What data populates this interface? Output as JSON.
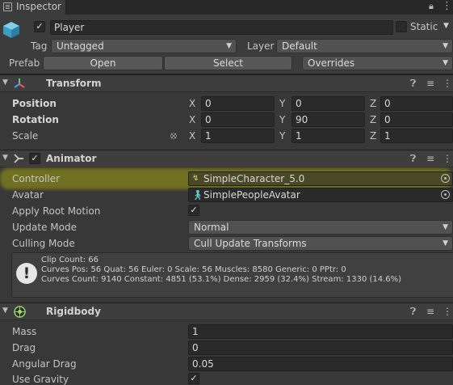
{
  "tab": {
    "title": "Inspector"
  },
  "header": {
    "name": "Player",
    "active_checked": true,
    "static_label": "Static",
    "tag_label": "Tag",
    "tag_value": "Untagged",
    "layer_label": "Layer",
    "layer_value": "Default",
    "prefab_label": "Prefab",
    "open_label": "Open",
    "select_label": "Select",
    "overrides_label": "Overrides"
  },
  "transform": {
    "title": "Transform",
    "position": {
      "label": "Position",
      "x": "0",
      "y": "0",
      "z": "0"
    },
    "rotation": {
      "label": "Rotation",
      "x": "0",
      "y": "90",
      "z": "0"
    },
    "scale": {
      "label": "Scale",
      "x": "1",
      "y": "1",
      "z": "1"
    },
    "axis_x": "X",
    "axis_y": "Y",
    "axis_z": "Z"
  },
  "animator": {
    "title": "Animator",
    "enabled": true,
    "controller_label": "Controller",
    "controller_value": "SimpleCharacter_5.0",
    "avatar_label": "Avatar",
    "avatar_value": "SimplePeopleAvatar",
    "apply_root_motion_label": "Apply Root Motion",
    "apply_root_motion": true,
    "update_mode_label": "Update Mode",
    "update_mode_value": "Normal",
    "culling_mode_label": "Culling Mode",
    "culling_mode_value": "Cull Update Transforms",
    "info_line1": "Clip Count: 66",
    "info_line2": "Curves Pos: 56 Quat: 56 Euler: 0 Scale: 56 Muscles: 8580 Generic: 0 PPtr: 0",
    "info_line3": "Curves Count: 9140 Constant: 4851 (53.1%) Dense: 2959 (32.4%) Stream: 1330 (14.6%)"
  },
  "rigidbody": {
    "title": "Rigidbody",
    "mass_label": "Mass",
    "mass_value": "1",
    "drag_label": "Drag",
    "drag_value": "0",
    "angular_drag_label": "Angular Drag",
    "angular_drag_value": "0.05",
    "use_gravity_label": "Use Gravity",
    "use_gravity": true
  },
  "colors": {
    "panel": "#383838",
    "header": "#3e3e3e",
    "field": "#2a2a2a",
    "highlight": "#bebe00"
  }
}
